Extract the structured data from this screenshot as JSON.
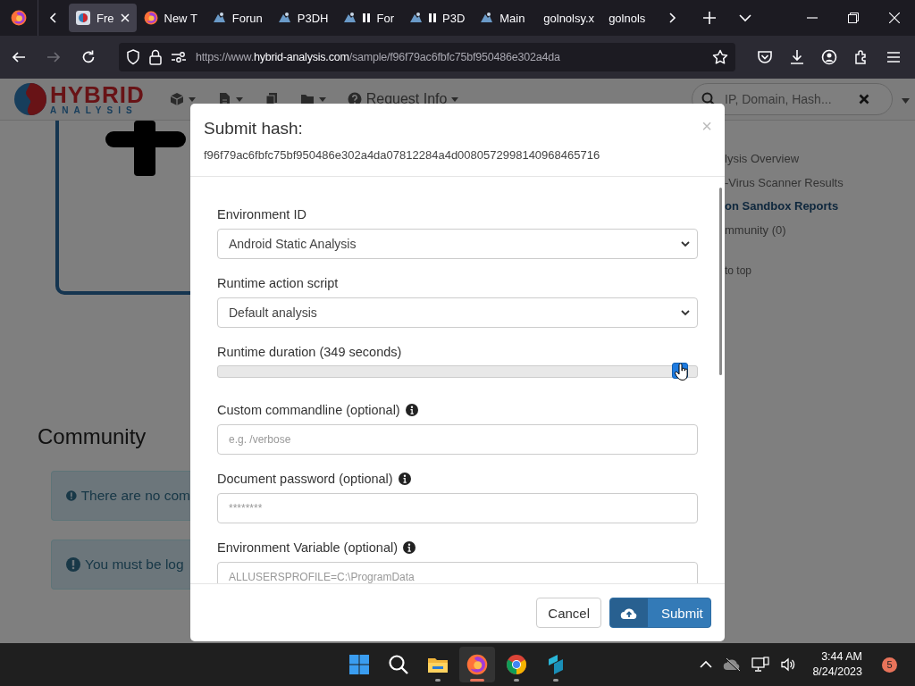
{
  "browser": {
    "tabs": [
      {
        "label": "Fre",
        "kind": "site",
        "selected": true,
        "paused": false
      },
      {
        "label": "New T",
        "kind": "firefox",
        "selected": false,
        "paused": false
      },
      {
        "label": "Forun",
        "kind": "forum",
        "selected": false,
        "paused": false
      },
      {
        "label": "P3DH",
        "kind": "forum",
        "selected": false,
        "paused": false
      },
      {
        "label": "For",
        "kind": "forum",
        "selected": false,
        "paused": true
      },
      {
        "label": "P3D",
        "kind": "forum",
        "selected": false,
        "paused": true
      },
      {
        "label": "Main",
        "kind": "forum",
        "selected": false,
        "paused": false
      },
      {
        "label": "golnolsy.x",
        "kind": "plain",
        "selected": false,
        "paused": false
      },
      {
        "label": "golnols",
        "kind": "plain",
        "selected": false,
        "paused": false
      }
    ],
    "nav_buttons": [
      {
        "kind": "back",
        "disabled": false
      },
      {
        "kind": "forward",
        "disabled": true
      },
      {
        "kind": "reload",
        "disabled": false
      }
    ],
    "url": {
      "scheme": "https://www.",
      "domain": "hybrid-analysis.com",
      "path": "/sample/f96f79ac6fbfc75bf950486e302a4da"
    }
  },
  "site": {
    "logo": {
      "top": "HYBRID",
      "bottom": "ANALYSIS"
    },
    "menu": [
      {
        "kind": "cube",
        "dropdown": true
      },
      {
        "kind": "file",
        "dropdown": true
      },
      {
        "kind": "copy",
        "dropdown": false
      },
      {
        "kind": "folder",
        "dropdown": true
      },
      {
        "kind": "help",
        "dropdown": true,
        "label": "Request Info"
      }
    ],
    "search": {
      "placeholder": "IP, Domain, Hash..."
    },
    "community": {
      "title": "Community",
      "alerts": [
        "There are no com",
        "You must be log"
      ]
    },
    "toc": [
      {
        "label": "lysis Overview",
        "selected": false
      },
      {
        "label": "-Virus Scanner Results",
        "selected": false
      },
      {
        "label": "on Sandbox Reports",
        "selected": true
      },
      {
        "label": "mmunity (0)",
        "selected": false
      },
      {
        "label": "to top",
        "selected": false
      }
    ]
  },
  "modal": {
    "title": "Submit hash:",
    "close": "×",
    "hash": "f96f79ac6fbfc75bf950486e302a4da07812284a4d0080572998140968465716",
    "fields": [
      {
        "kind": "select",
        "label": "Environment ID",
        "value": "Android Static Analysis",
        "info": false
      },
      {
        "kind": "select",
        "label": "Runtime action script",
        "value": "Default analysis",
        "info": false
      },
      {
        "kind": "slider",
        "label": "Runtime duration (349 seconds)",
        "level": 0.965,
        "info": false
      },
      {
        "kind": "input",
        "label": "Custom commandline (optional)",
        "placeholder": "e.g. /verbose",
        "info": true
      },
      {
        "kind": "input",
        "label": "Document password (optional)",
        "placeholder": "********",
        "info": true
      },
      {
        "kind": "input",
        "label": "Environment Variable (optional)",
        "placeholder": "ALLUSERSPROFILE=C:\\ProgramData",
        "info": true
      }
    ],
    "buttons": [
      {
        "kind": "cancel",
        "label": "Cancel"
      },
      {
        "kind": "submit",
        "label": "Submit"
      }
    ]
  },
  "taskbar": {
    "apps": [
      {
        "kind": "windows",
        "running": false,
        "active": false
      },
      {
        "kind": "search",
        "running": false,
        "active": false
      },
      {
        "kind": "files",
        "running": true,
        "active": false
      },
      {
        "kind": "firefox",
        "running": true,
        "active": true
      },
      {
        "kind": "chrome",
        "running": true,
        "active": false
      },
      {
        "kind": "app",
        "running": true,
        "active": false
      }
    ],
    "time": "3:44 AM",
    "date": "8/24/2023",
    "badge": {
      "text": "5",
      "color": "#e8735a"
    }
  }
}
